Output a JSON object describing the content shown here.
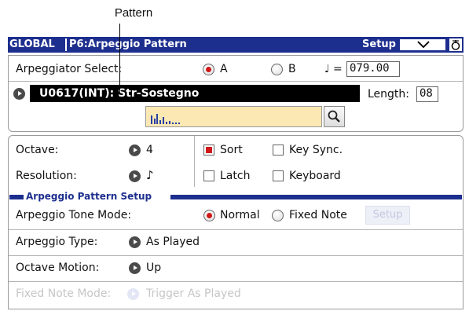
{
  "callout": "Pattern",
  "titlebar": {
    "mode": "GLOBAL",
    "page": "P6:Arpeggio Pattern",
    "setup": "Setup"
  },
  "arp_select": {
    "label": "Arpeggiator Select:",
    "option_a": "A",
    "option_b": "B",
    "selected": "A",
    "tempo_label": "♩ =",
    "tempo": "079.00"
  },
  "pattern": {
    "name": "U0617(INT): Str-Sostegno",
    "length_label": "Length:",
    "length": "08"
  },
  "octave": {
    "label": "Octave:",
    "value": "4"
  },
  "resolution": {
    "label": "Resolution:",
    "value": "♪"
  },
  "checkboxes": {
    "sort": "Sort",
    "sort_checked": true,
    "key_sync": "Key Sync.",
    "key_sync_checked": false,
    "latch": "Latch",
    "latch_checked": false,
    "keyboard": "Keyboard",
    "keyboard_checked": false
  },
  "section": {
    "title": "Arpeggio Pattern Setup"
  },
  "tone_mode": {
    "label": "Arpeggio Tone Mode:",
    "normal": "Normal",
    "fixed": "Fixed Note",
    "selected": "Normal",
    "setup": "Setup"
  },
  "arp_type": {
    "label": "Arpeggio Type:",
    "value": "As Played"
  },
  "octave_motion": {
    "label": "Octave Motion:",
    "value": "Up"
  },
  "fixed_note_mode": {
    "label": "Fixed Note Mode:",
    "value": "Trigger As Played"
  },
  "colors": {
    "title_bar": "#1d2f8e",
    "selected_red": "#d01818",
    "pattern_preview": "#fbe8b3"
  }
}
